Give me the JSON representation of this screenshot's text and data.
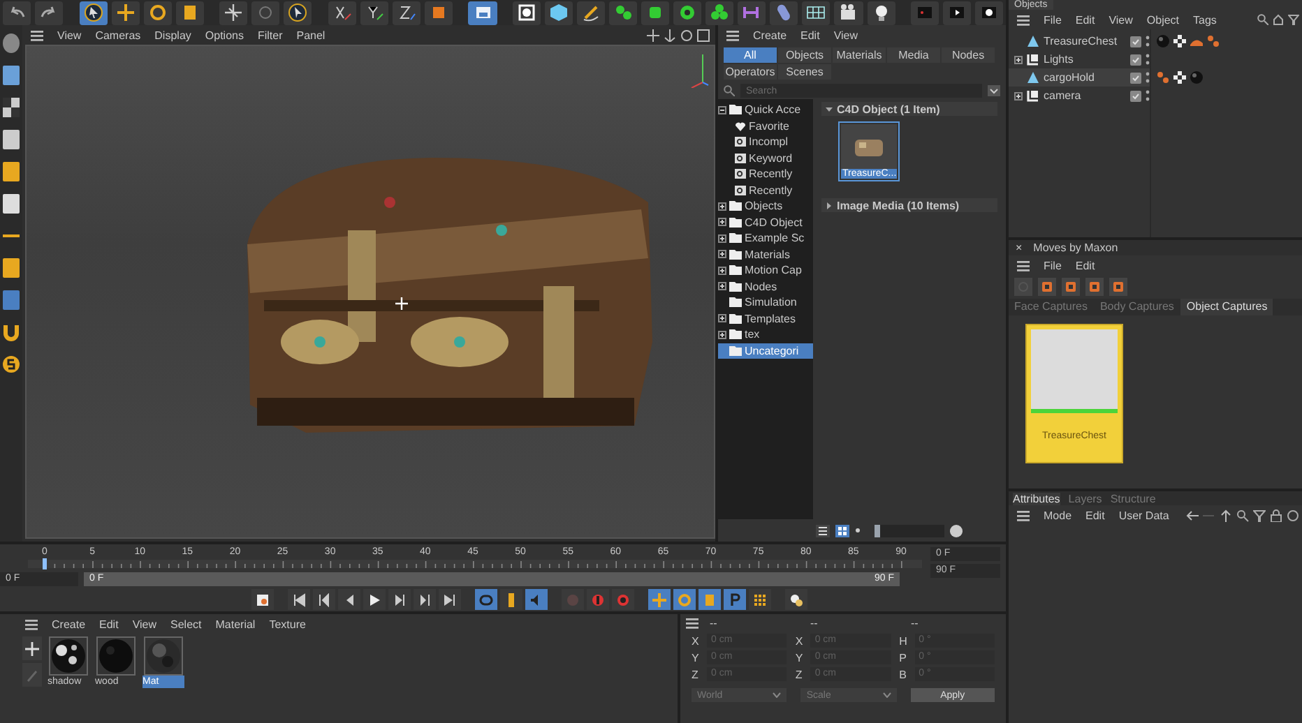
{
  "viewport": {
    "menu": [
      "View",
      "Cameras",
      "Display",
      "Options",
      "Filter",
      "Panel"
    ]
  },
  "content_browser": {
    "menu": [
      "Create",
      "Edit",
      "View"
    ],
    "tabs": [
      {
        "label": "All",
        "selected": true
      },
      {
        "label": "Objects",
        "selected": false
      },
      {
        "label": "Materials",
        "selected": false
      },
      {
        "label": "Media",
        "selected": false
      },
      {
        "label": "Nodes",
        "selected": false
      },
      {
        "label": "Operators",
        "selected": false
      },
      {
        "label": "Scenes",
        "selected": false
      }
    ],
    "search": {
      "placeholder": "Search"
    },
    "tree": [
      {
        "label": "Quick Acce",
        "expanded": true,
        "selected": false,
        "children": [
          {
            "label": "Favorite",
            "kind": "heart",
            "selected": false
          },
          {
            "label": "Incompl",
            "kind": "smart",
            "selected": false
          },
          {
            "label": "Keyword",
            "kind": "smart",
            "selected": false
          },
          {
            "label": "Recently",
            "kind": "smart",
            "selected": false
          },
          {
            "label": "Recently",
            "kind": "smart",
            "selected": false
          }
        ]
      },
      {
        "label": "Objects",
        "expanded": false,
        "selected": false
      },
      {
        "label": "C4D Object",
        "expanded": false,
        "selected": false
      },
      {
        "label": "Example Sc",
        "expanded": false,
        "selected": false
      },
      {
        "label": "Materials",
        "expanded": false,
        "selected": false
      },
      {
        "label": "Motion Cap",
        "expanded": false,
        "selected": false
      },
      {
        "label": "Nodes",
        "expanded": false,
        "selected": false
      },
      {
        "label": "Simulation",
        "selected": false
      },
      {
        "label": "Templates",
        "expanded": false,
        "selected": false
      },
      {
        "label": "tex",
        "expanded": false,
        "selected": false
      },
      {
        "label": "Uncategori",
        "selected": true
      }
    ],
    "groups": [
      {
        "title": "C4D Object (1 Item)",
        "expanded": true,
        "items": [
          {
            "label": "TreasureC...",
            "selected": true
          }
        ]
      },
      {
        "title": "Image Media (10 Items)",
        "expanded": false
      }
    ],
    "view_modes": [
      {
        "kind": "list",
        "selected": false
      },
      {
        "kind": "grid",
        "selected": true
      }
    ],
    "icon_size": {
      "level": 0.08
    }
  },
  "objects": {
    "tab": "Objects",
    "menu": [
      "File",
      "Edit",
      "View",
      "Object",
      "Tags"
    ],
    "items": [
      {
        "name": "TreasureChest",
        "kind": "polygon",
        "selected": false,
        "tags": [
          {
            "kind": "material"
          },
          {
            "kind": "checker"
          },
          {
            "kind": "shape"
          },
          {
            "kind": "dots"
          }
        ]
      },
      {
        "name": "Lights",
        "kind": "null",
        "expanded": false,
        "selected": false
      },
      {
        "name": "cargoHold",
        "kind": "polygon",
        "selected": true,
        "tags": [
          {
            "kind": "dots"
          },
          {
            "kind": "checker"
          },
          {
            "kind": "material"
          }
        ]
      },
      {
        "name": "camera",
        "kind": "null",
        "expanded": false,
        "selected": false
      }
    ]
  },
  "moves": {
    "close": "×",
    "title": "Moves by Maxon",
    "menu": [
      "File",
      "Edit"
    ],
    "tabs": [
      {
        "label": "Face Captures",
        "selected": false
      },
      {
        "label": "Body Captures",
        "selected": false
      },
      {
        "label": "Object Captures",
        "selected": true
      }
    ],
    "captures": [
      {
        "label": "TreasureChest",
        "selected": true
      }
    ]
  },
  "attributes": {
    "tabs": [
      {
        "label": "Attributes",
        "selected": true
      },
      {
        "label": "Layers",
        "selected": false
      },
      {
        "label": "Structure",
        "selected": false
      }
    ],
    "menu": [
      "Mode",
      "Edit",
      "User Data"
    ]
  },
  "timeline": {
    "ticks": [
      "0",
      "5",
      "10",
      "15",
      "20",
      "25",
      "30",
      "35",
      "40",
      "45",
      "50",
      "55",
      "60",
      "65",
      "70",
      "75",
      "80",
      "85",
      "90"
    ],
    "playhead": {
      "level": 0
    },
    "start": "0 F",
    "range_start": "0 F",
    "range_end": "90 F",
    "current": "0 F",
    "end": "90 F"
  },
  "materials": {
    "menu": [
      "Create",
      "Edit",
      "View",
      "Select",
      "Material",
      "Texture"
    ],
    "items": [
      {
        "name": "shadow",
        "kind": "mottled",
        "selected": false
      },
      {
        "name": "wood",
        "kind": "dark",
        "selected": false
      },
      {
        "name": "Mat",
        "kind": "glossy",
        "selected": true
      }
    ]
  },
  "coordinates": {
    "headers": [
      "--",
      "--",
      "--"
    ],
    "disabled": true,
    "rows": [
      {
        "cells": [
          {
            "axis": "X",
            "value": "0 cm"
          },
          {
            "axis": "X",
            "value": "0 cm"
          },
          {
            "axis": "H",
            "value": "0 °"
          }
        ]
      },
      {
        "cells": [
          {
            "axis": "Y",
            "value": "0 cm"
          },
          {
            "axis": "Y",
            "value": "0 cm"
          },
          {
            "axis": "P",
            "value": "0 °"
          }
        ]
      },
      {
        "cells": [
          {
            "axis": "Z",
            "value": "0 cm"
          },
          {
            "axis": "Z",
            "value": "0 cm"
          },
          {
            "axis": "B",
            "value": "0 °"
          }
        ]
      }
    ],
    "dropdowns": [
      "World",
      "Scale"
    ],
    "apply": "Apply"
  }
}
